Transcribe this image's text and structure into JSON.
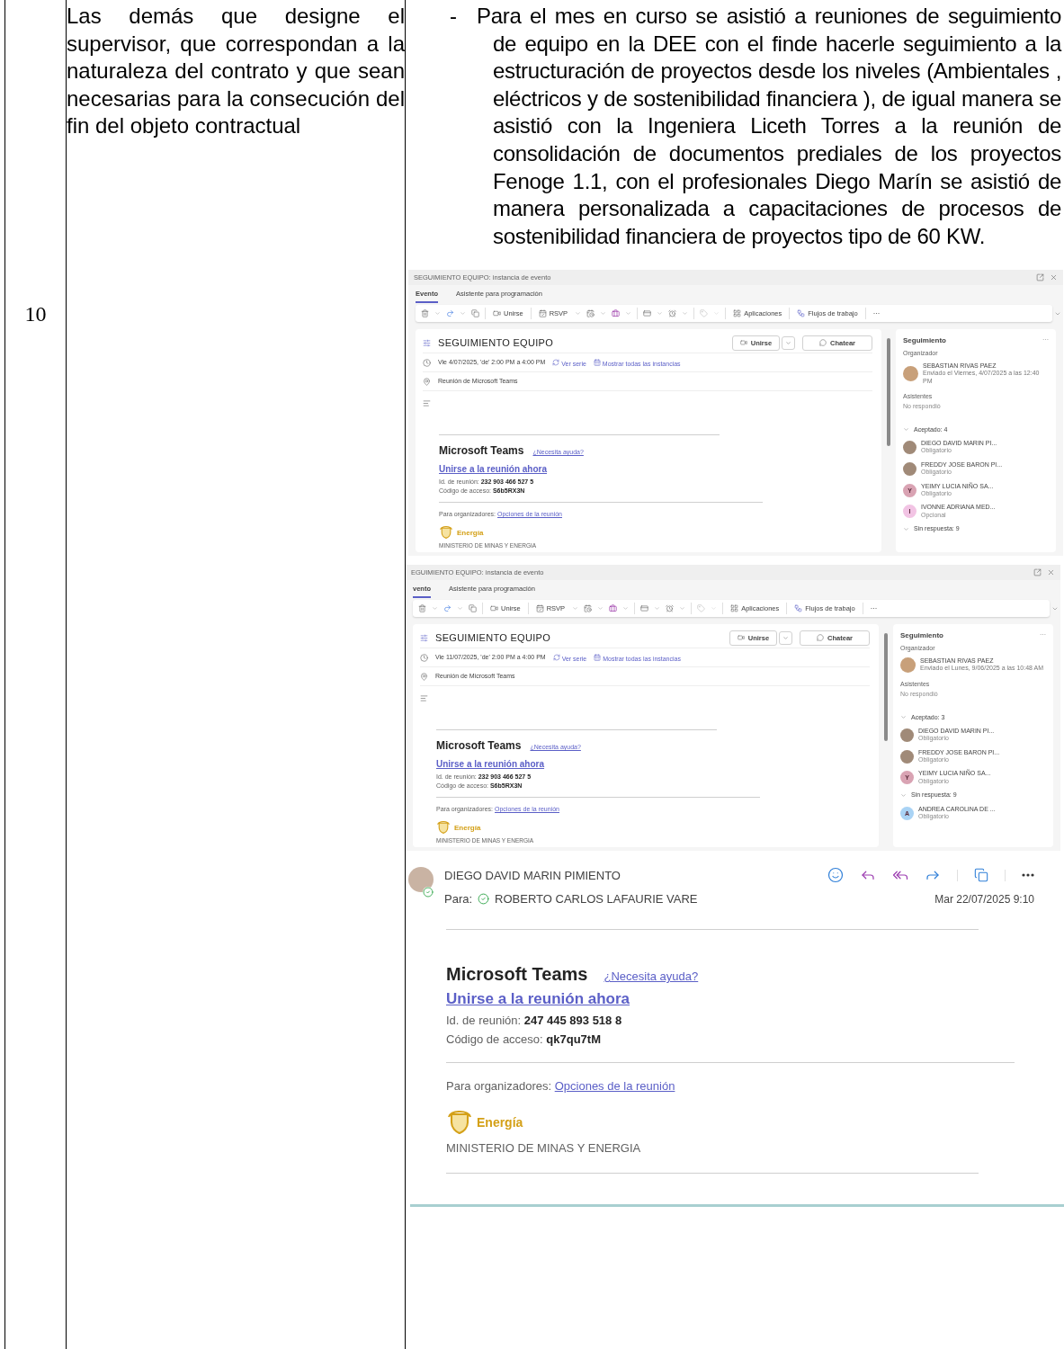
{
  "row": {
    "number": "10",
    "obligation": "Las demás que designe el supervisor, que correspondan a la naturaleza del contrato y que sean necesarias para la consecución del fin del objeto contractual",
    "bullet": "-",
    "activity": "Para el mes en curso se asistió a reuniones de seguimiento de equipo en la DEE con el finde hacerle seguimiento a la estructuración de proyectos desde los niveles (Ambientales , eléctricos y de sostenibilidad financiera ), de igual manera se asistió con la Ingeniera Liceth Torres a la reunión de consolidación de documentos prediales de los proyectos Fenoge 1.1, con el profesionales Diego Marín se asistió de manera personalizada a capacitaciones de procesos de sostenibilidad financiera de proyectos tipo de 60 KW."
  },
  "event_windows": [
    {
      "title": "SEGUIMIENTO EQUIPO: instancia de evento",
      "tabs": [
        {
          "label": "Evento",
          "selected": true
        },
        {
          "label": "Asistente para programación",
          "selected": false
        }
      ],
      "toolbar": {
        "join": "Unirse",
        "rsvp": "RSVP",
        "apps": "Aplicaciones",
        "flows": "Flujos de trabajo",
        "more": "···"
      },
      "subject": "SEGUIMIENTO EQUIPO",
      "join_button": "Unirse",
      "chat_button": "Chatear",
      "date": "Vie 4/07/2025, 'de' 2:00 PM a 4:00 PM",
      "series_link": "Ver serie",
      "instances_link": "Mostrar todas las instancias",
      "location": "Reunión de Microsoft Teams",
      "teams": {
        "heading": "Microsoft Teams",
        "help_link": "¿Necesita ayuda?",
        "join_link": "Unirse a la reunión ahora",
        "id_line": "Id. de reunión: **232 903 466 527 5**",
        "passcode_line": "Código de acceso: **S6b5RX3N**",
        "organizers_label": "Para organizadores:",
        "options_link": "Opciones de la reunión",
        "brand": "Energía",
        "ministry": "MINISTERIO DE MINAS Y ENERGIA"
      },
      "tracking": {
        "title": "Seguimiento",
        "more": "···",
        "organizer_label": "Organizador",
        "organizer": {
          "name": "SEBASTIAN RIVAS PAEZ",
          "sent": "Enviado el Viernes, 4/07/2025 a las 12:40 PM"
        },
        "attendees_label": "Asistentes",
        "no_response": "No respondió",
        "groups": [
          {
            "label": "Aceptado: 4",
            "expanded": true,
            "people": [
              {
                "name": "DIEGO DAVID MARIN PI...",
                "role": "Obligatorio",
                "kind": "photo"
              },
              {
                "name": "FREDDY JOSE BARON PI...",
                "role": "Obligatorio",
                "kind": "photo"
              },
              {
                "name": "YEIMY LUCIA NIÑO SA...",
                "role": "Obligatorio",
                "kind": "initial",
                "initial": "Y",
                "color": "#d9a3b3"
              },
              {
                "name": "IVONNE ADRIANA MED...",
                "role": "Opcional",
                "kind": "initial",
                "initial": "I",
                "color": "#f2c4e4"
              }
            ]
          },
          {
            "label": "Sin respuesta: 9",
            "expanded": true
          }
        ]
      }
    },
    {
      "title": "EGUIMIENTO EQUIPO: instancia de evento",
      "tabs": [
        {
          "label": "vento",
          "selected": true
        },
        {
          "label": "Asistente para programación",
          "selected": false
        }
      ],
      "toolbar": {
        "join": "Unirse",
        "rsvp": "RSVP",
        "apps": "Aplicaciones",
        "flows": "Flujos de trabajo",
        "more": "···"
      },
      "subject": "SEGUIMIENTO EQUIPO",
      "join_button": "Unirse",
      "chat_button": "Chatear",
      "date": "Vie 11/07/2025, 'de' 2:00 PM a 4:00 PM",
      "series_link": "Ver serie",
      "instances_link": "Mostrar todas las instancias",
      "location": "Reunión de Microsoft Teams",
      "teams": {
        "heading": "Microsoft Teams",
        "help_link": "¿Necesita ayuda?",
        "join_link": "Unirse a la reunión ahora",
        "id_line": "Id. de reunión: **232 903 466 527 5**",
        "passcode_line": "Código de acceso: **S6b5RX3N**",
        "organizers_label": "Para organizadores:",
        "options_link": "Opciones de la reunión",
        "brand": "Energía",
        "ministry": "MINISTERIO DE MINAS Y ENERGIA"
      },
      "tracking": {
        "title": "Seguimiento",
        "more": "···",
        "organizer_label": "Organizador",
        "organizer": {
          "name": "SEBASTIAN RIVAS PAEZ",
          "sent": "Enviado el Lunes, 9/06/2025 a las 10:48 AM"
        },
        "attendees_label": "Asistentes",
        "no_response": "No respondió",
        "groups": [
          {
            "label": "Aceptado: 3",
            "expanded": true,
            "people": [
              {
                "name": "DIEGO DAVID MARIN PI...",
                "role": "Obligatorio",
                "kind": "photo"
              },
              {
                "name": "FREDDY JOSE BARON PI...",
                "role": "Obligatorio",
                "kind": "photo"
              },
              {
                "name": "YEIMY LUCIA NIÑO SA...",
                "role": "Obligatorio",
                "kind": "initial",
                "initial": "Y",
                "color": "#d9a3b3"
              }
            ]
          },
          {
            "label": "Sin respuesta: 9",
            "expanded": true,
            "people": [
              {
                "name": "ANDREA CAROLINA DE ...",
                "role": "Obligatorio",
                "kind": "initial",
                "initial": "A",
                "color": "#a9d3f5"
              }
            ]
          }
        ]
      }
    }
  ],
  "email": {
    "sender": "DIEGO DAVID MARIN PIMIENTO",
    "to_label": "Para:",
    "recipient": "ROBERTO CARLOS LAFAURIE VARE",
    "date": "Mar 22/07/2025 9:10",
    "teams": {
      "heading": "Microsoft Teams",
      "help_link": "¿Necesita ayuda?",
      "join_link": "Unirse a la reunión ahora",
      "id_line": "Id. de reunión: **247 445 893 518 8**",
      "passcode_line": "Código de acceso: **qk7qu7tM**",
      "organizers_label": "Para organizadores:",
      "options_link": "Opciones de la reunión",
      "brand": "Energía",
      "ministry": "MINISTERIO DE MINAS Y ENERGIA"
    }
  }
}
